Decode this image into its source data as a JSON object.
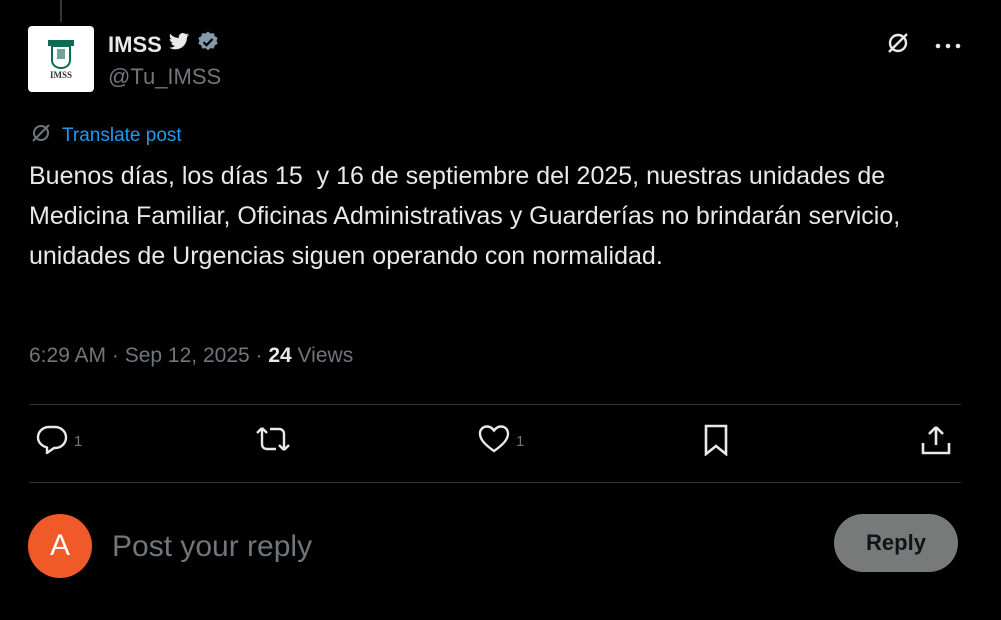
{
  "author": {
    "display_name": "IMSS",
    "handle": "@Tu_IMSS",
    "avatar_logo_text": "IMSS"
  },
  "translate": {
    "label": "Translate post"
  },
  "post": {
    "text": "Buenos días, los días 15  y 16 de septiembre del 2025, nuestras unidades de Medicina Familiar, Oficinas Administrativas y Guarderías no brindarán servicio, unidades de Urgencias siguen operando con normalidad."
  },
  "meta": {
    "time": "6:29 AM",
    "separator": " · ",
    "date": "Sep 12, 2025",
    "views_count": "24",
    "views_label": " Views"
  },
  "actions": {
    "reply_count": "1",
    "repost_count": "",
    "like_count": "1"
  },
  "reply_box": {
    "avatar_letter": "A",
    "placeholder": "Post your reply",
    "button_label": "Reply"
  },
  "colors": {
    "background": "#000000",
    "text": "#e7e9ea",
    "muted": "#71767b",
    "link": "#1d9bf0",
    "verified": "#829aab",
    "reply_avatar": "#f05a28"
  },
  "icons": [
    "twitter-bird-icon",
    "verified-badge-icon",
    "grok-icon",
    "more-icon",
    "translate-icon",
    "reply-icon",
    "repost-icon",
    "like-icon",
    "bookmark-icon",
    "share-icon"
  ]
}
